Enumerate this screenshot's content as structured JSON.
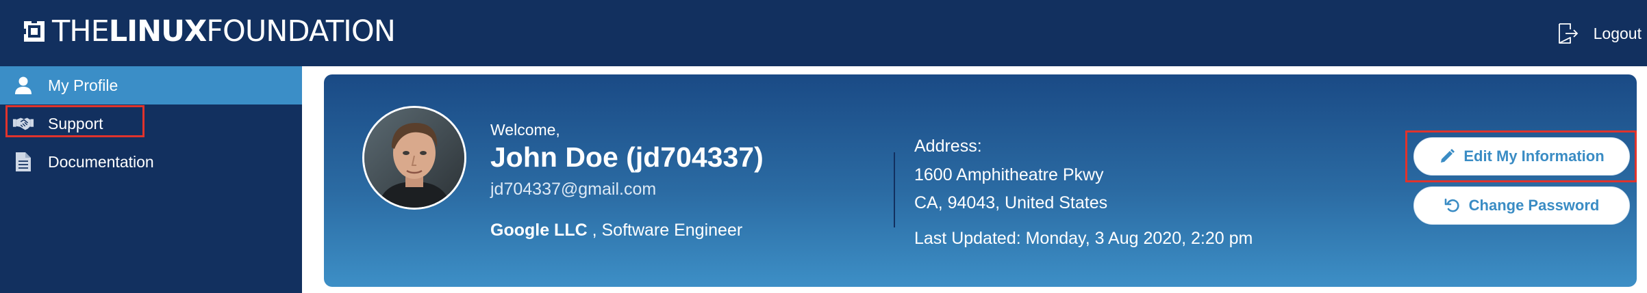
{
  "header": {
    "logo_thin_1": "THE",
    "logo_bold": "LINUX",
    "logo_thin_2": "FOUNDATION",
    "logout_label": "Logout"
  },
  "sidebar": {
    "items": [
      {
        "label": "My Profile",
        "icon": "person-icon",
        "active": true
      },
      {
        "label": "Support",
        "icon": "handshake-icon",
        "active": false
      },
      {
        "label": "Documentation",
        "icon": "document-icon",
        "active": false
      }
    ]
  },
  "profile": {
    "welcome": "Welcome,",
    "name": "John Doe (jd704337)",
    "email": "jd704337@gmail.com",
    "company": "Google LLC",
    "role_suffix": " , Software Engineer",
    "address_label": "Address:",
    "address_line1": "1600 Amphitheatre Pkwy",
    "address_line2": "CA, 94043, United States",
    "last_updated": "Last Updated: Monday, 3 Aug 2020, 2:20 pm"
  },
  "actions": {
    "edit_label": "Edit My Information",
    "change_password_label": "Change Password"
  },
  "colors": {
    "header_bg": "#12305f",
    "active_nav": "#3b8ec7",
    "button_text": "#3a8cc4",
    "highlight": "#e0332c"
  }
}
